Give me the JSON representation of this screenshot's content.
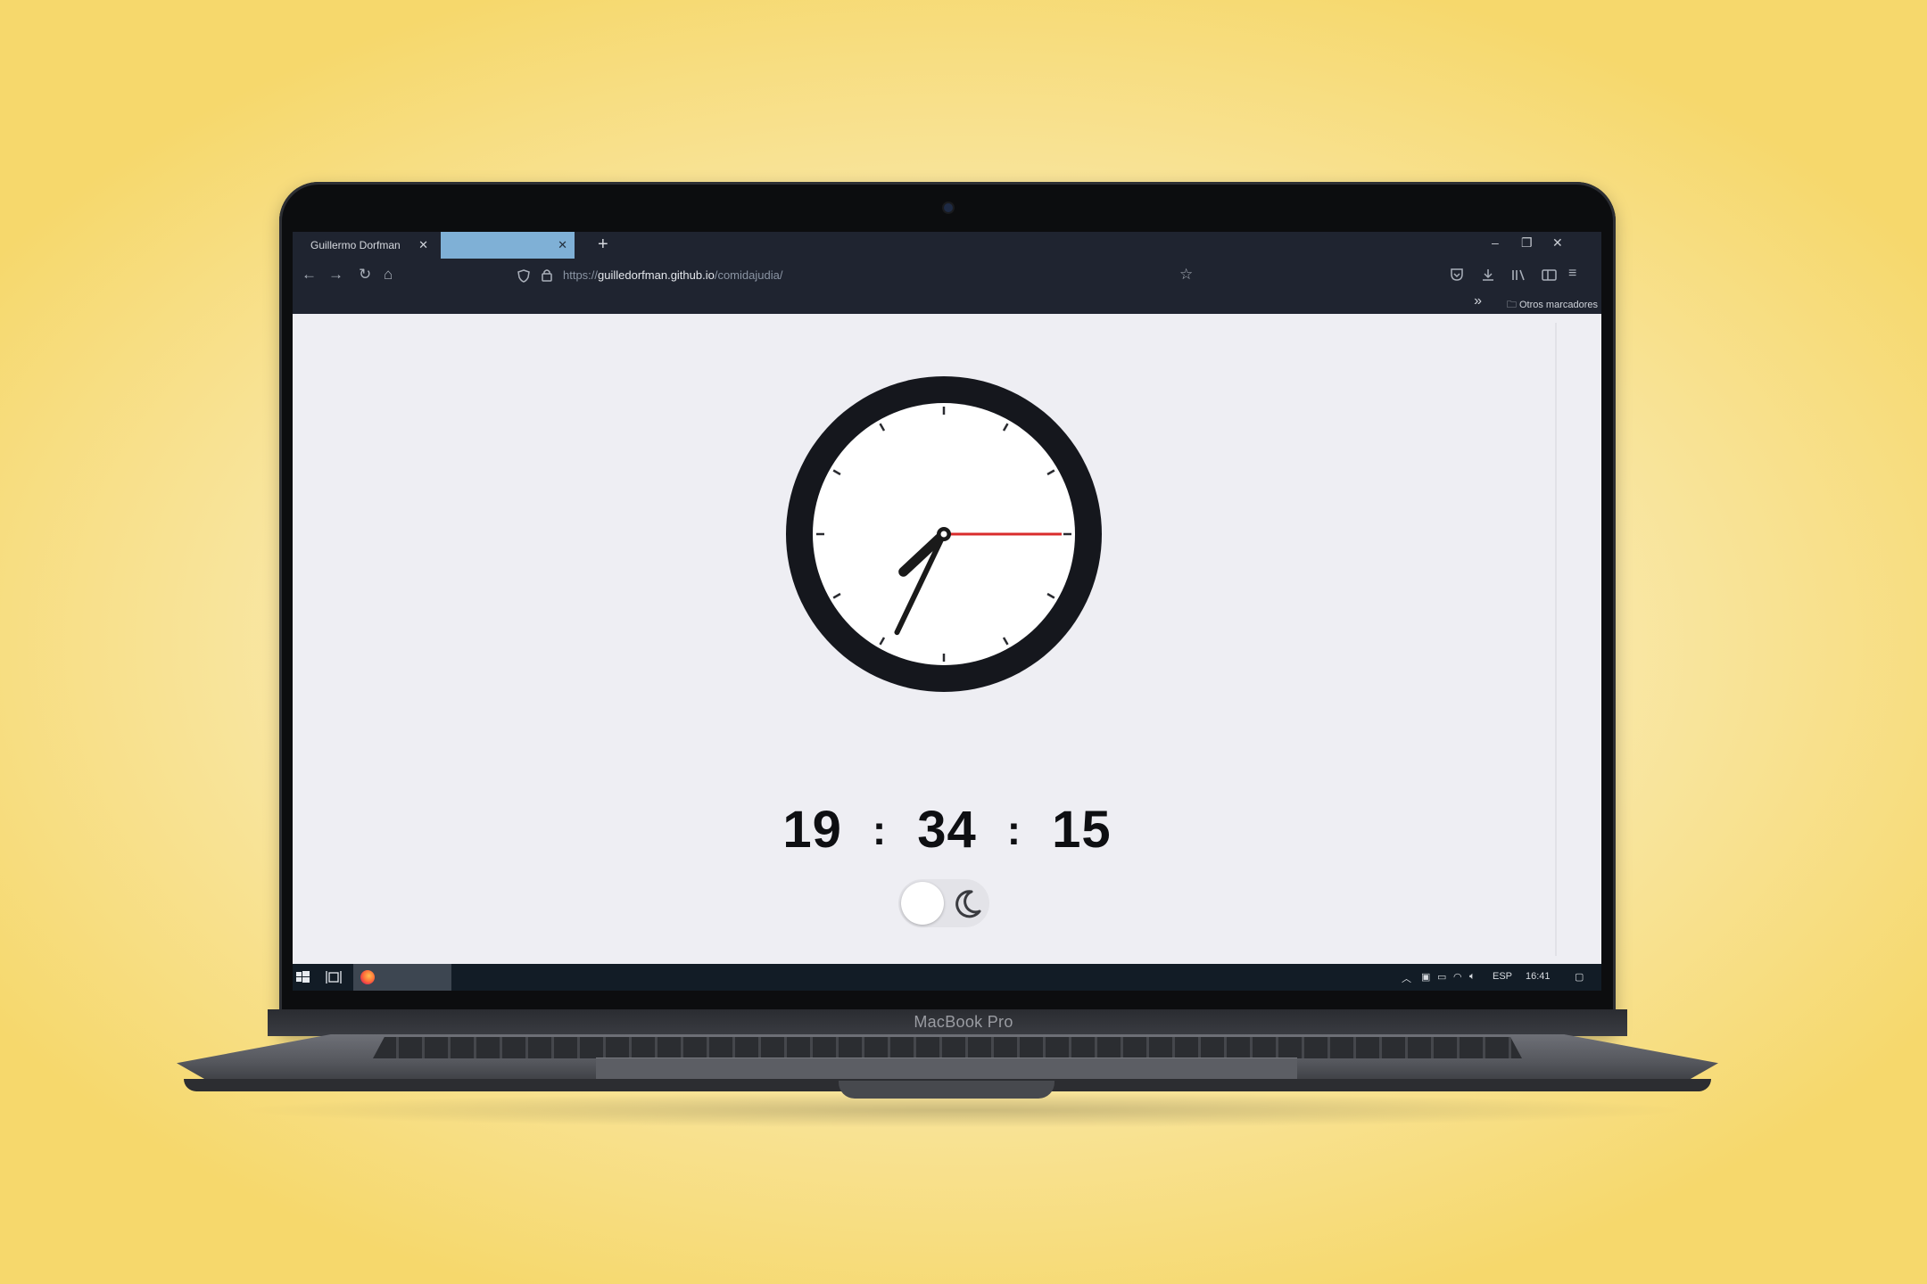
{
  "browser": {
    "tabs": [
      {
        "label": "Guillermo Dorfman",
        "active": false
      },
      {
        "label": "",
        "active": true
      }
    ],
    "new_tab": "+",
    "url_prefix": "https://",
    "url_host": "guilledorfman.github.io",
    "url_path": "/comidajudia/",
    "bookmarks_folder": "Otros marcadores",
    "window_controls": [
      "minimize",
      "restore",
      "close"
    ]
  },
  "clock": {
    "hours": "19",
    "minutes": "34",
    "seconds": "15",
    "separator": ":",
    "colors": {
      "face": "#ffffff",
      "rim": "#15171d",
      "hands": "#1a1a1a",
      "second_hand": "#d92c2c",
      "page_background": "#eeeef3"
    }
  },
  "theme_toggle": {
    "state": "light",
    "icon": "moon-icon"
  },
  "taskbar": {
    "language": "ESP",
    "time": "16:41",
    "apps": [
      "firefox-icon"
    ]
  },
  "device": {
    "brand": "MacBook Pro"
  }
}
